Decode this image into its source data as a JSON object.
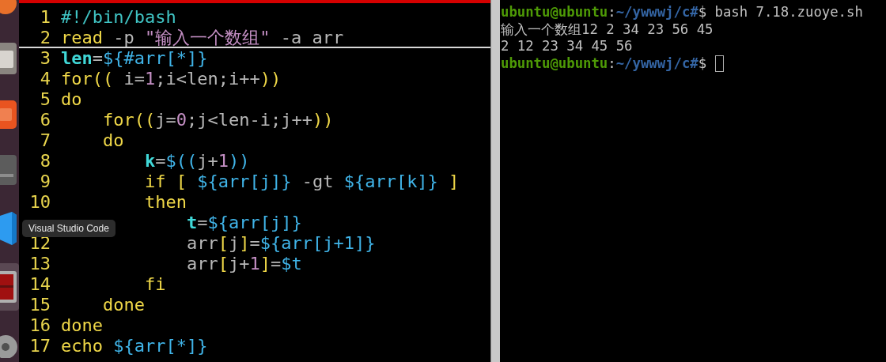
{
  "dock": {
    "items": [
      {
        "kind": "browser",
        "selected": false
      },
      {
        "kind": "files",
        "selected": false
      },
      {
        "kind": "store",
        "selected": false
      },
      {
        "kind": "disk",
        "selected": false
      },
      {
        "kind": "vscode",
        "selected": false
      },
      {
        "kind": "toolbox",
        "selected": true
      },
      {
        "kind": "disc",
        "selected": false
      }
    ],
    "tooltip": "Visual Studio Code"
  },
  "editor": {
    "lines": [
      {
        "number": "1",
        "cursor_line": false,
        "tokens": [
          {
            "text": "#!/bin/bash",
            "kind": "comment"
          }
        ]
      },
      {
        "number": "2",
        "cursor_line": true,
        "tokens": [
          {
            "text": "read",
            "kind": "keyword"
          },
          {
            "text": " -p ",
            "kind": "plain"
          },
          {
            "text": "\"输入一个数组\"",
            "kind": "string"
          },
          {
            "text": " -a arr",
            "kind": "plain"
          }
        ]
      },
      {
        "number": "3",
        "cursor_line": false,
        "tokens": [
          {
            "text": "len",
            "kind": "variable"
          },
          {
            "text": "=",
            "kind": "plain"
          },
          {
            "text": "${#arr[*]}",
            "kind": "expansion"
          }
        ]
      },
      {
        "number": "4",
        "cursor_line": false,
        "tokens": [
          {
            "text": "for((",
            "kind": "keyword"
          },
          {
            "text": " i=",
            "kind": "plain"
          },
          {
            "text": "1",
            "kind": "number"
          },
          {
            "text": ";i<len;i++",
            "kind": "plain"
          },
          {
            "text": "))",
            "kind": "keyword"
          }
        ]
      },
      {
        "number": "5",
        "cursor_line": false,
        "tokens": [
          {
            "text": "do",
            "kind": "keyword"
          }
        ]
      },
      {
        "number": "6",
        "cursor_line": false,
        "tokens": [
          {
            "text": "    for((",
            "kind": "keyword"
          },
          {
            "text": "j=",
            "kind": "plain"
          },
          {
            "text": "0",
            "kind": "number"
          },
          {
            "text": ";j<len-i;j++",
            "kind": "plain"
          },
          {
            "text": "))",
            "kind": "keyword"
          }
        ]
      },
      {
        "number": "7",
        "cursor_line": false,
        "tokens": [
          {
            "text": "    do",
            "kind": "keyword"
          }
        ]
      },
      {
        "number": "8",
        "cursor_line": false,
        "tokens": [
          {
            "text": "        k",
            "kind": "variable"
          },
          {
            "text": "=",
            "kind": "plain"
          },
          {
            "text": "$((",
            "kind": "expansion"
          },
          {
            "text": "j+",
            "kind": "plain"
          },
          {
            "text": "1",
            "kind": "number"
          },
          {
            "text": "))",
            "kind": "expansion"
          }
        ]
      },
      {
        "number": "9",
        "cursor_line": false,
        "tokens": [
          {
            "text": "        if [ ",
            "kind": "keyword"
          },
          {
            "text": "${arr[j]}",
            "kind": "expansion"
          },
          {
            "text": " -gt ",
            "kind": "plain"
          },
          {
            "text": "${arr[k]}",
            "kind": "expansion"
          },
          {
            "text": " ]",
            "kind": "keyword"
          }
        ]
      },
      {
        "number": "10",
        "cursor_line": false,
        "tokens": [
          {
            "text": "        then",
            "kind": "keyword"
          }
        ]
      },
      {
        "cursor_line": false,
        "tokens": [
          {
            "text": "            t",
            "kind": "variable"
          },
          {
            "text": "=",
            "kind": "plain"
          },
          {
            "text": "${arr[j]}",
            "kind": "expansion"
          }
        ]
      },
      {
        "number": "12",
        "cursor_line": false,
        "tokens": [
          {
            "text": "            arr",
            "kind": "plain"
          },
          {
            "text": "[",
            "kind": "keyword"
          },
          {
            "text": "j",
            "kind": "plain"
          },
          {
            "text": "]",
            "kind": "keyword"
          },
          {
            "text": "=",
            "kind": "plain"
          },
          {
            "text": "${arr[j+1]}",
            "kind": "expansion"
          }
        ]
      },
      {
        "number": "13",
        "cursor_line": false,
        "tokens": [
          {
            "text": "            arr",
            "kind": "plain"
          },
          {
            "text": "[",
            "kind": "keyword"
          },
          {
            "text": "j+",
            "kind": "plain"
          },
          {
            "text": "1",
            "kind": "number"
          },
          {
            "text": "]",
            "kind": "keyword"
          },
          {
            "text": "=",
            "kind": "plain"
          },
          {
            "text": "$t",
            "kind": "expansion"
          }
        ]
      },
      {
        "number": "14",
        "cursor_line": false,
        "tokens": [
          {
            "text": "        fi",
            "kind": "keyword"
          }
        ]
      },
      {
        "number": "15",
        "cursor_line": false,
        "tokens": [
          {
            "text": "    done",
            "kind": "keyword"
          }
        ]
      },
      {
        "number": "16",
        "cursor_line": false,
        "tokens": [
          {
            "text": "done",
            "kind": "keyword"
          }
        ]
      },
      {
        "number": "17",
        "cursor_line": false,
        "tokens": [
          {
            "text": "echo ",
            "kind": "keyword"
          },
          {
            "text": "${arr[*]}",
            "kind": "expansion"
          }
        ]
      }
    ]
  },
  "terminal": {
    "cursor": true,
    "lines": [
      {
        "segments": [
          {
            "text": "ubuntu@ubuntu",
            "kind": "user"
          },
          {
            "text": ":",
            "kind": "plain"
          },
          {
            "text": "~/ywwwj/c#",
            "kind": "path"
          },
          {
            "text": "$ bash 7.18.zuoye.sh",
            "kind": "plain"
          }
        ]
      },
      {
        "segments": [
          {
            "text": "输入一个数组12 2 34 23 56 45",
            "kind": "plain"
          }
        ]
      },
      {
        "segments": [
          {
            "text": "2 12 23 34 45 56",
            "kind": "plain"
          }
        ]
      },
      {
        "segments": [
          {
            "text": "ubuntu@ubuntu",
            "kind": "user"
          },
          {
            "text": ":",
            "kind": "plain"
          },
          {
            "text": "~/ywwwj/c#",
            "kind": "path"
          },
          {
            "text": "$ ",
            "kind": "plain"
          }
        ]
      }
    ]
  }
}
